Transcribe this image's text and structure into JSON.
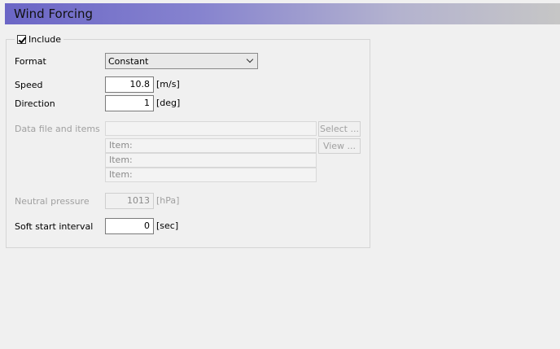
{
  "header": {
    "title": "Wind Forcing"
  },
  "include": {
    "label": "Include",
    "checked": true
  },
  "format": {
    "label": "Format",
    "value": "Constant"
  },
  "speed": {
    "label": "Speed",
    "value": "10.8",
    "unit": "[m/s]"
  },
  "direction": {
    "label": "Direction",
    "value": "1",
    "unit": "[deg]"
  },
  "data_file": {
    "label": "Data file and items",
    "file_value": "",
    "select_label": "Select ...",
    "view_label": "View ...",
    "items": [
      "Item:",
      "Item:",
      "Item:"
    ]
  },
  "neutral_pressure": {
    "label": "Neutral pressure",
    "value": "1013",
    "unit": "[hPa]"
  },
  "soft_start": {
    "label": "Soft start interval",
    "value": "0",
    "unit": "[sec]"
  }
}
